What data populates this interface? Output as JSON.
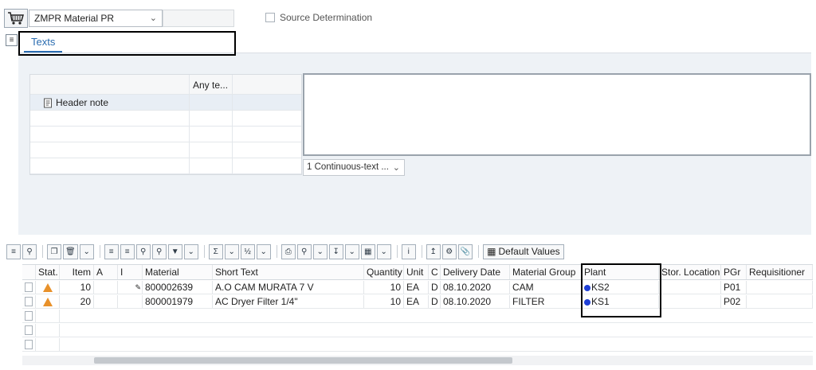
{
  "header": {
    "doc_type": "ZMPR Material PR",
    "source_determination": "Source Determination"
  },
  "tabs": [
    {
      "label": "Texts"
    }
  ],
  "text_types": {
    "col_any_text": "Any te...",
    "items": [
      {
        "label": "Header note"
      }
    ]
  },
  "editor": {
    "format": "1 Continuous-text ..."
  },
  "toolbar": {
    "default_values": "Default Values"
  },
  "items_grid": {
    "columns": [
      "Stat.",
      "Item",
      "A",
      "I",
      "Material",
      "Short Text",
      "Quantity",
      "Unit",
      "C",
      "Delivery Date",
      "Material Group",
      "Plant",
      "Stor. Location",
      "PGr",
      "Requisitioner"
    ],
    "rows": [
      {
        "item": "10",
        "material": "800002639",
        "short_text": "A.O CAM MURATA 7 V",
        "quantity": "10",
        "unit": "EA",
        "c": "D",
        "delivery_date": "08.10.2020",
        "material_group": "CAM",
        "plant": "KS2",
        "stor_location": "",
        "pgr": "P01",
        "requisitioner": ""
      },
      {
        "item": "20",
        "material": "800001979",
        "short_text": "AC Dryer Filter 1/4\"",
        "quantity": "10",
        "unit": "EA",
        "c": "D",
        "delivery_date": "08.10.2020",
        "material_group": "FILTER",
        "plant": "KS1",
        "stor_location": "",
        "pgr": "P02",
        "requisitioner": ""
      }
    ]
  },
  "colors": {
    "accent": "#2a6cb0",
    "warning": "#e8912a",
    "plant_marker": "#1f3fd6"
  }
}
